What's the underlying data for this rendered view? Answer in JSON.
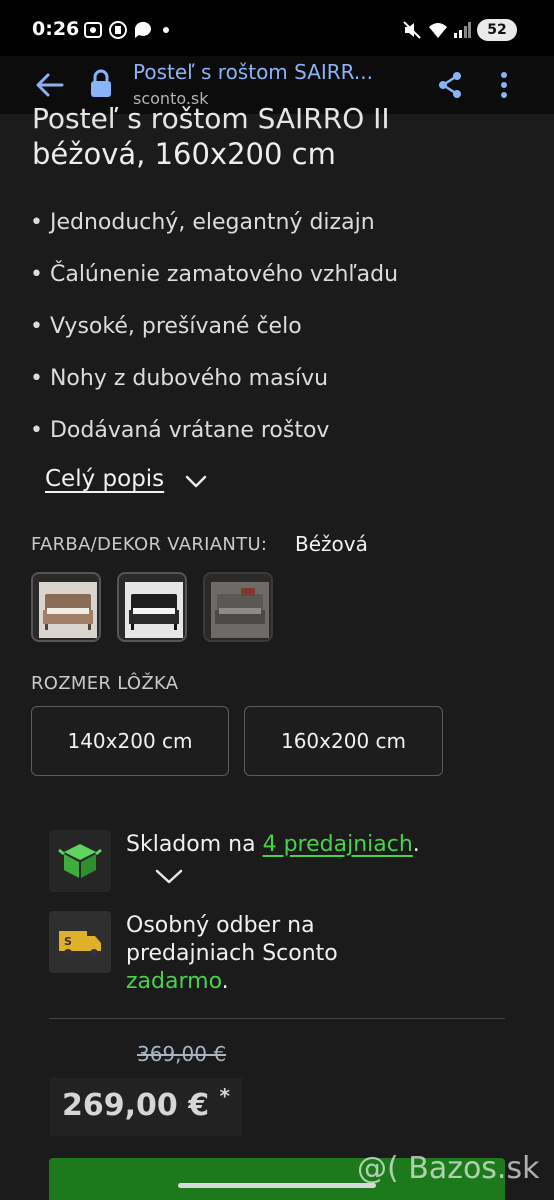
{
  "status_bar": {
    "time": "0:26",
    "battery": "52"
  },
  "browser": {
    "page_title": "Posteľ s roštom SAIRR...",
    "domain": "sconto.sk"
  },
  "product": {
    "title_cut": "Posteľ s roštom SAIRRO II",
    "title_line2": "béžová, 160x200 cm",
    "bullets": [
      "• Jednoduchý, elegantný dizajn",
      "• Čalúnenie zamatového vzhľadu",
      "• Vysoké, prešívané čelo",
      "• Nohy z dubového masívu",
      "• Dodávaná vrátane roštov"
    ],
    "full_description_link": "Celý popis"
  },
  "variant": {
    "label": "FARBA/DEKOR VARIANTU:",
    "selected": "Béžová",
    "thumbs": [
      "beige-bed",
      "black-bed",
      "grey-bed"
    ]
  },
  "size": {
    "label": "ROZMER LÔŽKA",
    "options": [
      "140x200 cm",
      "160x200 cm"
    ]
  },
  "availability": {
    "text_before": "Skladom na ",
    "stores_link": "4 predajniach",
    "text_after": ".",
    "pickup_line1": "Osobný odber na",
    "pickup_line2": "predajniach Sconto",
    "pickup_free": "zadarmo",
    "pickup_after": "."
  },
  "pricing": {
    "old_price": "369,00 €",
    "price": "269,00 €",
    "asterisk": "*"
  },
  "watermark": "@( Bazos.sk",
  "colors": {
    "accent_green": "#4ad14a",
    "link_blue": "#8ab4f8",
    "background": "#1b1b1b"
  }
}
